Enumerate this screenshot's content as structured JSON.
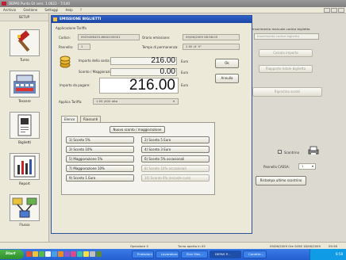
{
  "app": {
    "title": "DEPAS Punto Gt vers. 1.0622 - 7/140",
    "menu": [
      "Archivio",
      "Gestione",
      "Settaggi",
      "Help",
      "?"
    ]
  },
  "sidebar": {
    "header": "SETUP",
    "items": [
      {
        "label": "Turno",
        "icon": "hammer-icon"
      },
      {
        "label": "Tessere",
        "icon": "cash-register-icon"
      },
      {
        "label": "Biglietti",
        "icon": "ticket-icon"
      },
      {
        "label": "Report",
        "icon": "report-chart-icon"
      },
      {
        "label": "Flusso",
        "icon": "flow-icon"
      }
    ]
  },
  "dialog": {
    "title": "EMISSIONE BIGLIETTI",
    "section_tariff": "Applicazione Tariffa",
    "codice_label": "Codice:",
    "codice_value": "0929496453-8640105001",
    "orario_label": "Orario emissione:",
    "orario_value": "09/06/2009 08:58:05",
    "pannello_label": "Pannello:",
    "pannello_value": "1",
    "tempo_label": "Tempo di permanenza:",
    "tempo_value": "2.00 (4' 0\"",
    "importo_sosta_label": "Importo della sosta:",
    "importo_sosta_value": "216.00",
    "sconto_label": "Sconto / Maggiorazione:",
    "sconto_value": "0.00",
    "importo_label": "Importo da pagare:",
    "importo_value": "216.00",
    "euro": "Euro",
    "ok_button": "Ok",
    "annulla_button": "Annulla",
    "applica_label": "Applica Tariffa:",
    "applica_value": "1.00 (400 otta",
    "tabs": [
      "Elenco A",
      "Riassunti"
    ],
    "new_button": "Nuovo sconto / maggiorazione",
    "discounts": [
      [
        "1) Sconto 5%",
        "2) Sconto 5 Euro"
      ],
      [
        "3) Sconto 10%",
        "4) Sconto 3 Euro"
      ],
      [
        "5) Maggiorazione 5%",
        "6) Sconto 5% occasionali"
      ],
      [
        "7) Maggiorazione 10%",
        "8) Sconto 10% occasionali"
      ],
      [
        "9) Sconto 1 Euro",
        "10) Sconto 0% (ercoste cure)"
      ]
    ]
  },
  "right_panel": {
    "title": "Inserimento manuale codice biglietto",
    "code_placeholder": "Inserimento codice biglietto",
    "calc_button": "Calcola importo",
    "release_button": "Riapporto totale biglietto",
    "extra_button": "Ripristina sconti",
    "scontrino_label": "Scontrino",
    "pannello_label": "Pannello CASSA:",
    "pannello_value": "1",
    "stampa_button": "Ristampa ultimo scontrino"
  },
  "status": {
    "operator": "Operatore 0",
    "turno": "Turno aperto in 05",
    "date": "09/06/2009 Ore 0058 18/06/2009",
    "time": "09:58"
  },
  "taskbar": {
    "start": "Start",
    "buttons": [
      "Protezioni",
      "Lavoratoro",
      "Elen files...",
      "DEPAS P...",
      "Corrette..."
    ],
    "clock": "8:58"
  }
}
